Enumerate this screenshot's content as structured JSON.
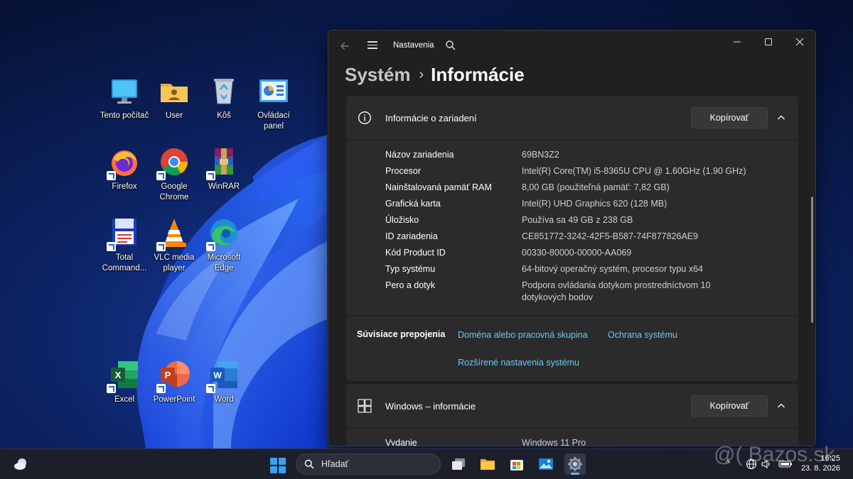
{
  "desktop": {
    "icons": [
      {
        "label": "Tento počítač"
      },
      {
        "label": "User"
      },
      {
        "label": "Kôš"
      },
      {
        "label": "Ovládací panel"
      },
      {
        "label": "Firefox"
      },
      {
        "label": "Google Chrome"
      },
      {
        "label": "WinRAR"
      },
      {
        "label": "Total Command..."
      },
      {
        "label": "VLC media player"
      },
      {
        "label": "Microsoft Edge"
      },
      {
        "label": "Excel"
      },
      {
        "label": "PowerPoint"
      },
      {
        "label": "Word"
      }
    ]
  },
  "window": {
    "app_title": "Nastavenia",
    "breadcrumb": {
      "parent": "Systém",
      "separator": "›",
      "current": "Informácie"
    },
    "device_card": {
      "title": "Informácie o zariadení",
      "copy_label": "Kopírovať",
      "specs": [
        {
          "key": "Názov zariadenia",
          "value": "69BN3Z2"
        },
        {
          "key": "Procesor",
          "value": "Intel(R) Core(TM) i5-8365U CPU @ 1.60GHz (1.90 GHz)"
        },
        {
          "key": "Nainštalovaná pamäť RAM",
          "value": "8,00 GB (použiteľná pamäť: 7,82 GB)"
        },
        {
          "key": "Grafická karta",
          "value": "Intel(R) UHD Graphics 620 (128 MB)"
        },
        {
          "key": "Úložisko",
          "value": "Používa sa 49 GB z 238 GB"
        },
        {
          "key": "ID zariadenia",
          "value": "CE851772-3242-42F5-B587-74F877826AE9"
        },
        {
          "key": "Kód Product ID",
          "value": "00330-80000-00000-AA069"
        },
        {
          "key": "Typ systému",
          "value": "64-bitový operačný systém, procesor typu x64"
        },
        {
          "key": "Pero a dotyk",
          "value": "Podpora ovládania dotykom prostredníctvom 10 dotykových bodov"
        }
      ],
      "related": {
        "label": "Súvisiace prepojenia",
        "links": [
          "Doména alebo pracovná skupina",
          "Ochrana systému",
          "Rozšírené nastavenia systému"
        ]
      }
    },
    "windows_card": {
      "title": "Windows – informácie",
      "copy_label": "Kopírovať",
      "partial_key": "Vydanie",
      "partial_value": "Windows 11 Pro"
    }
  },
  "taskbar": {
    "search_placeholder": "Hľadať",
    "time": "16:25",
    "date": "23. 8. 2026",
    "tray_arrow": "^"
  },
  "watermark": "@( Bazos.sk",
  "colors": {
    "window_bg": "#202020",
    "card_bg": "#2b2b2b",
    "link": "#6cc8f0",
    "accent": "#3aa0f0"
  }
}
